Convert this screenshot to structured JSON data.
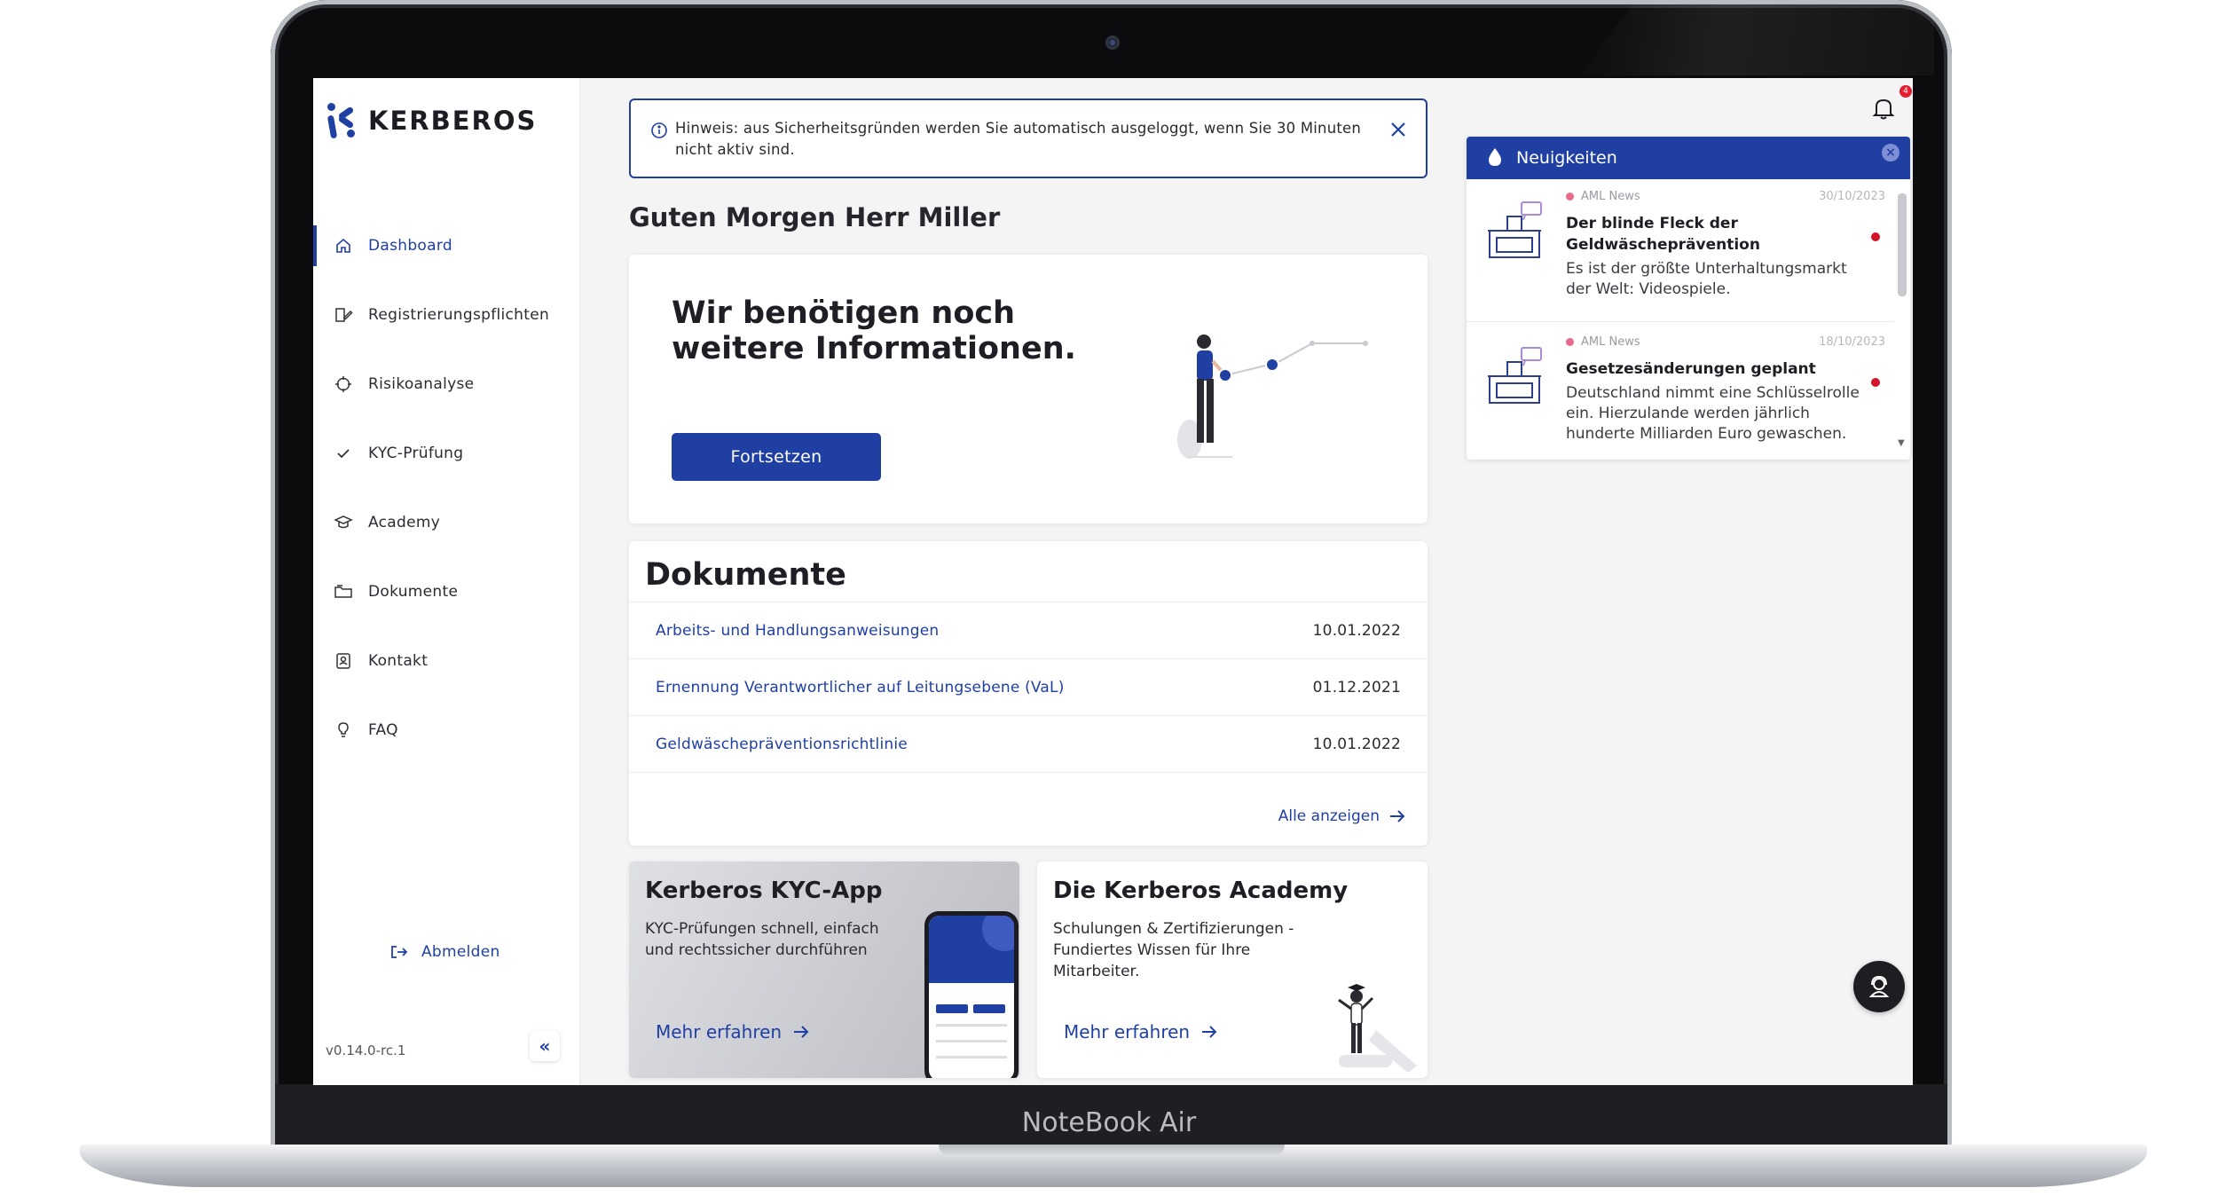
{
  "device": {
    "model_label": "NoteBook Air"
  },
  "sidebar": {
    "brand": "KERBEROS",
    "items": [
      {
        "label": "Dashboard",
        "icon": "home-icon",
        "active": true
      },
      {
        "label": "Registrierungspflichten",
        "icon": "document-edit-icon",
        "active": false
      },
      {
        "label": "Risikoanalyse",
        "icon": "crosshair-icon",
        "active": false
      },
      {
        "label": "KYC-Prüfung",
        "icon": "check-icon",
        "active": false
      },
      {
        "label": "Academy",
        "icon": "graduation-cap-icon",
        "active": false
      },
      {
        "label": "Dokumente",
        "icon": "folder-icon",
        "active": false
      },
      {
        "label": "Kontakt",
        "icon": "contact-card-icon",
        "active": false
      },
      {
        "label": "FAQ",
        "icon": "lightbulb-icon",
        "active": false
      }
    ],
    "logout_label": "Abmelden",
    "version": "v0.14.0-rc.1",
    "collapse_label": "«"
  },
  "notice": {
    "text": "Hinweis: aus Sicherheitsgründen werden Sie automatisch ausgeloggt, wenn Sie 30 Minuten nicht aktiv sind."
  },
  "greeting": "Guten Morgen Herr Miller",
  "info_card": {
    "title": "Wir benötigen noch weitere Informationen.",
    "button_label": "Fortsetzen"
  },
  "documents": {
    "title": "Dokumente",
    "rows": [
      {
        "name": "Arbeits- und Handlungsanweisungen",
        "date": "10.01.2022"
      },
      {
        "name": "Ernennung Verantwortlicher auf Leitungsebene (VaL)",
        "date": "01.12.2021"
      },
      {
        "name": "Geldwäschepräventionsrichtlinie",
        "date": "10.01.2022"
      }
    ],
    "show_all_label": "Alle anzeigen"
  },
  "promos": {
    "kyc": {
      "title": "Kerberos KYC-App",
      "text": "KYC-Prüfungen schnell, einfach und rechtssicher durchführen",
      "link_label": "Mehr erfahren"
    },
    "academy": {
      "title": "Die Kerberos Academy",
      "text": "Schulungen & Zertifizierungen - Fundiertes Wissen für Ihre Mitarbeiter.",
      "link_label": "Mehr erfahren"
    }
  },
  "notifications": {
    "badge_count": "4"
  },
  "news": {
    "title": "Neuigkeiten",
    "items": [
      {
        "source": "AML News",
        "date": "30/10/2023",
        "title": "Der blinde Fleck der Geldwäscheprävention",
        "text": "Es ist der größte Unterhaltungsmarkt der Welt: Videospiele."
      },
      {
        "source": "AML News",
        "date": "18/10/2023",
        "title": "Gesetzesänderungen geplant",
        "text": "Deutschland nimmt eine Schlüsselrolle ein. Hierzulande werden jährlich hunderte Milliarden Euro gewaschen."
      }
    ]
  },
  "colors": {
    "accent": "#1f3fa3",
    "unread": "#d3132a"
  }
}
